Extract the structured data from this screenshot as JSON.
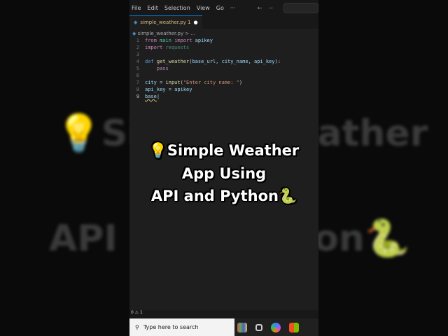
{
  "menu": [
    "File",
    "Edit",
    "Selection",
    "View",
    "Go",
    "···"
  ],
  "tab": {
    "label": "simple_weather.py 1",
    "modified": "●"
  },
  "breadcrumb": "simple_weather.py > ...",
  "code": [
    {
      "n": "1",
      "html": "<span class='kw'>from</span> <span class='mod'>main</span> <span class='kw'>import</span> <span class='var'>apikey</span>"
    },
    {
      "n": "2",
      "html": "<span class='kw'>import</span> <span class='dim'>requests</span>"
    },
    {
      "n": "3",
      "html": ""
    },
    {
      "n": "4",
      "html": "<span class='def'>def</span> <span class='fn'>get_weather</span><span class='plain'>(</span><span class='var'>base_url</span><span class='plain'>, </span><span class='var'>city_name</span><span class='plain'>, </span><span class='var'>api_key</span><span class='plain'>):</span>"
    },
    {
      "n": "5",
      "html": "&nbsp;&nbsp;&nbsp;&nbsp;<span class='kw'>pass</span>"
    },
    {
      "n": "6",
      "html": ""
    },
    {
      "n": "7",
      "html": "<span class='var'>city</span> <span class='plain'>=</span> <span class='fn'>input</span><span class='plain'>(</span><span class='str'>\"Enter city name: \"</span><span class='plain'>)</span>"
    },
    {
      "n": "8",
      "html": "<span class='var'>api_key</span> <span class='plain'>=</span> <span class='var'>apikey</span>"
    },
    {
      "n": "9",
      "html": "<span class='var' style='text-decoration:underline wavy #d7ba7d'>base</span><span class='plain'>|</span>"
    }
  ],
  "status": "0 ⚠ 1",
  "taskbar": {
    "search_placeholder": "Type here to search"
  },
  "overlay": {
    "line1": "💡Simple Weather",
    "line2": "App Using",
    "line3": "API and Python🐍"
  }
}
